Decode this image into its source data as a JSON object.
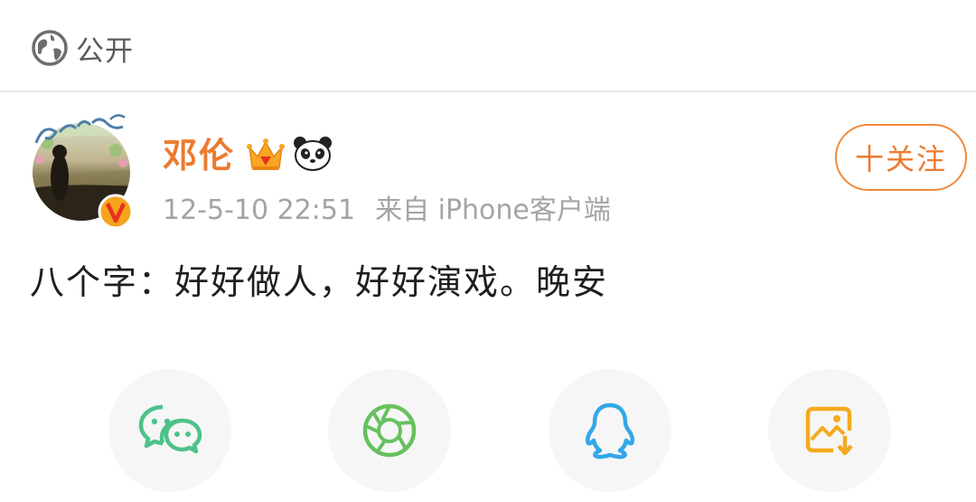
{
  "visibility": {
    "icon": "globe-icon",
    "label": "公开"
  },
  "post": {
    "author": {
      "name": "邓伦",
      "avatar_icon": "avatar",
      "verified_badge": "verified-badge-icon",
      "badges": [
        "crown-icon",
        "panda-icon"
      ],
      "name_color": "#ec7b2f"
    },
    "timestamp": "12-5-10 22:51",
    "source": "来自 iPhone客户端",
    "text": "八个字：好好做人，好好演戏。晚安",
    "follow_label": "十关注"
  },
  "share": {
    "items": [
      {
        "icon": "wechat-icon",
        "color": "#4cc28a"
      },
      {
        "icon": "moments-icon",
        "color": "#67c15e"
      },
      {
        "icon": "qq-icon",
        "color": "#32a7e8"
      },
      {
        "icon": "save-image-icon",
        "color": "#f5a91e"
      }
    ]
  },
  "colors": {
    "accent": "#ec7b2f",
    "meta_text": "#a4a4a4",
    "divider": "#e5e5e5"
  }
}
